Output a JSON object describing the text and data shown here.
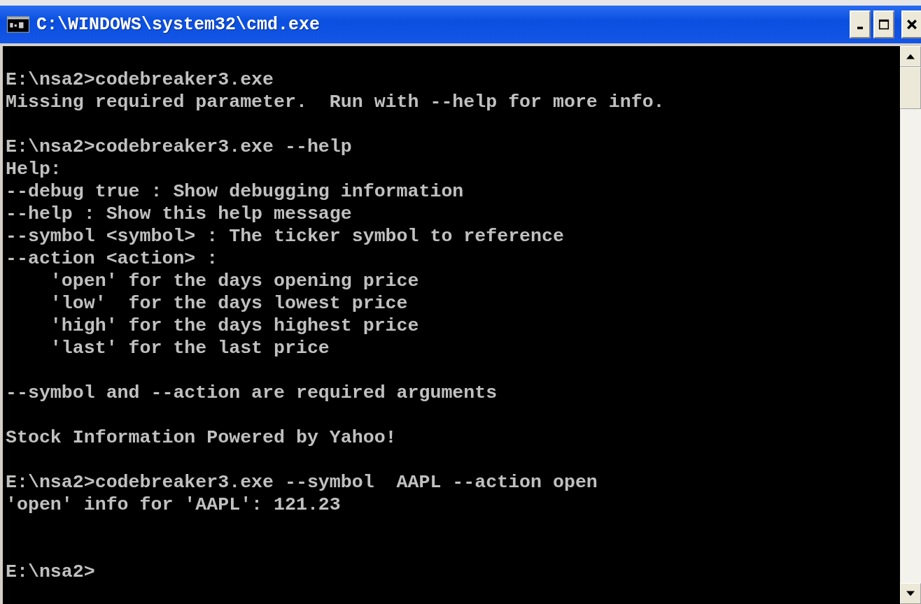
{
  "window": {
    "title": "C:\\WINDOWS\\system32\\cmd.exe"
  },
  "console": {
    "lines": [
      {
        "kind": "blank"
      },
      {
        "kind": "text",
        "text": "E:\\nsa2>codebreaker3.exe"
      },
      {
        "kind": "text",
        "text": "Missing required parameter.  Run with --help for more info."
      },
      {
        "kind": "blank"
      },
      {
        "kind": "text",
        "text": "E:\\nsa2>codebreaker3.exe --help"
      },
      {
        "kind": "text",
        "text": "Help:"
      },
      {
        "kind": "text",
        "text": "--debug true : Show debugging information"
      },
      {
        "kind": "text",
        "text": "--help : Show this help message"
      },
      {
        "kind": "text",
        "text": "--symbol <symbol> : The ticker symbol to reference"
      },
      {
        "kind": "text",
        "text": "--action <action> :"
      },
      {
        "kind": "text",
        "text": "    'open' for the days opening price"
      },
      {
        "kind": "text",
        "text": "    'low'  for the days lowest price"
      },
      {
        "kind": "text",
        "text": "    'high' for the days highest price"
      },
      {
        "kind": "text",
        "text": "    'last' for the last price"
      },
      {
        "kind": "blank"
      },
      {
        "kind": "text",
        "text": "--symbol and --action are required arguments"
      },
      {
        "kind": "blank"
      },
      {
        "kind": "text",
        "text": "Stock Information Powered by Yahoo!"
      },
      {
        "kind": "blank"
      },
      {
        "kind": "text",
        "text": "E:\\nsa2>codebreaker3.exe --symbol  AAPL --action open"
      },
      {
        "kind": "text",
        "text": "'open' info for 'AAPL': 121.23"
      },
      {
        "kind": "blank"
      },
      {
        "kind": "blank"
      },
      {
        "kind": "text",
        "text": "E:\\nsa2>"
      }
    ]
  }
}
